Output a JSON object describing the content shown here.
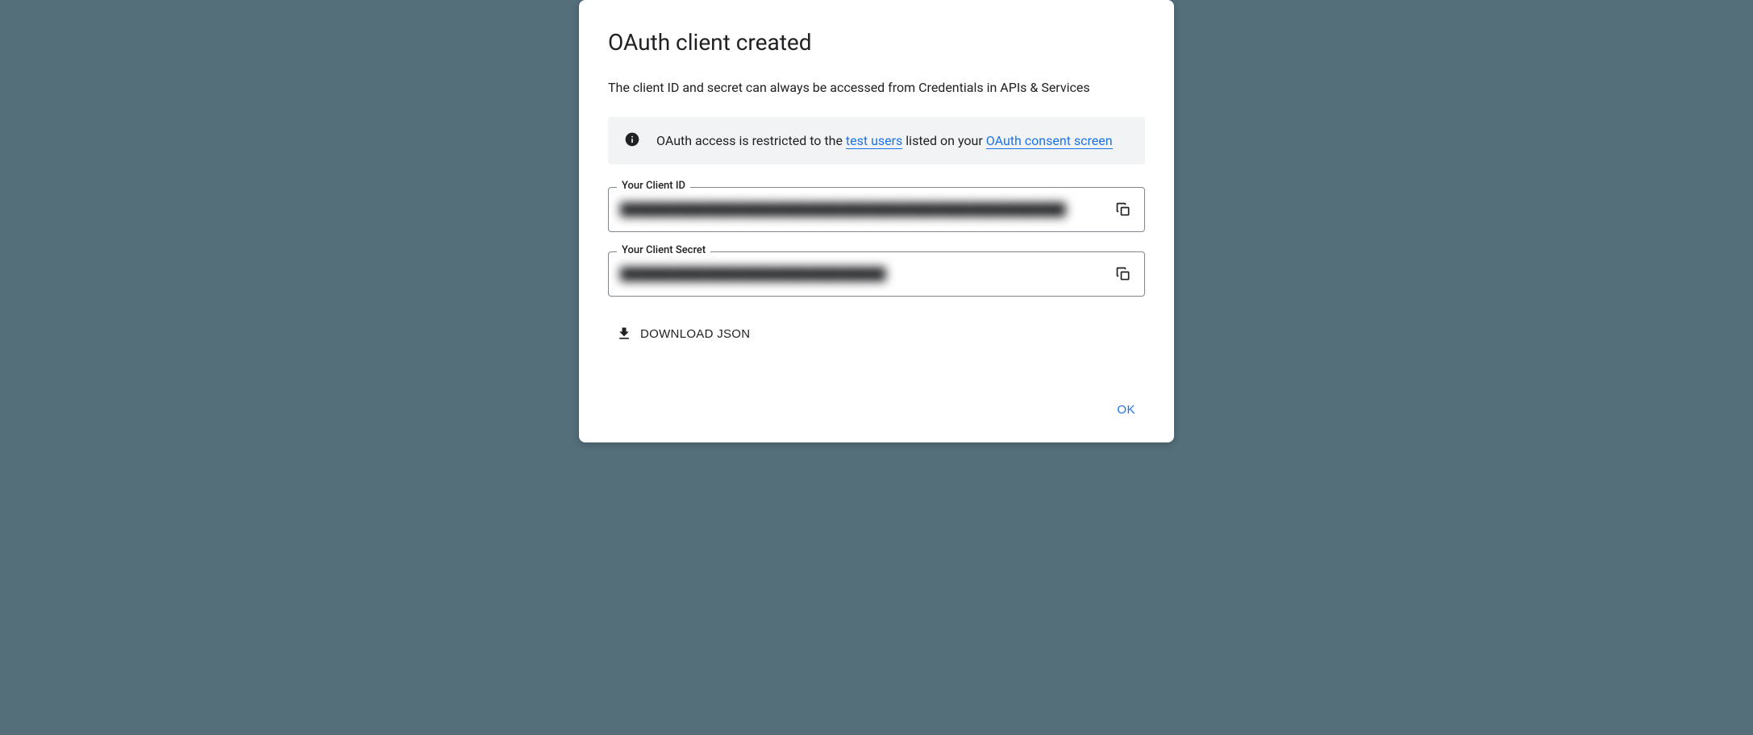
{
  "dialog": {
    "title": "OAuth client created",
    "description": "The client ID and secret can always be accessed from Credentials in APIs & Services",
    "info_banner": {
      "text_prefix": "OAuth access is restricted to the ",
      "link_test_users": "test users",
      "text_middle": " listed on your ",
      "link_consent": "OAuth consent screen"
    },
    "client_id": {
      "label": "Your Client ID",
      "value": "████████████████████████████████████████████████████"
    },
    "client_secret": {
      "label": "Your Client Secret",
      "value": "███████████████████████████████"
    },
    "download_label": "DOWNLOAD JSON",
    "ok_label": "OK"
  }
}
